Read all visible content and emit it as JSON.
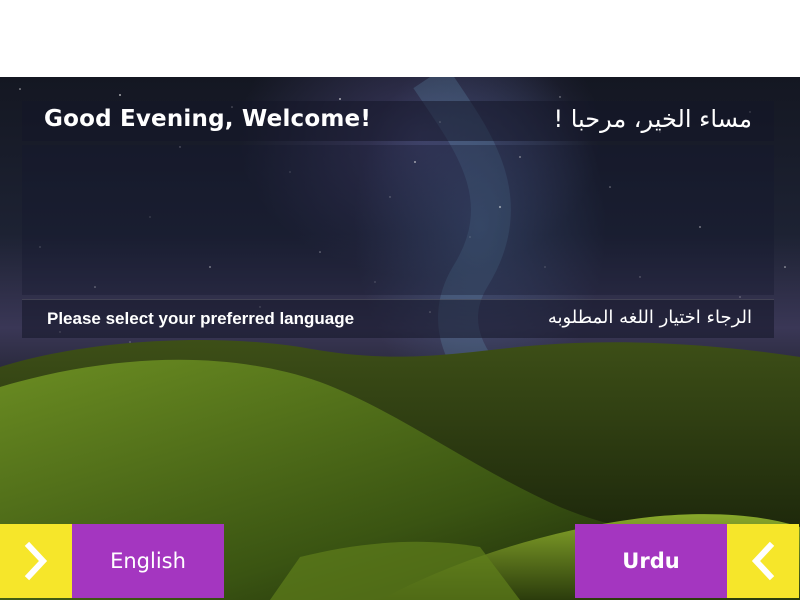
{
  "greeting": {
    "english": "Good Evening, Welcome!",
    "arabic": "مساء الخير، مرحبا !"
  },
  "prompt": {
    "english": "Please select your preferred language",
    "arabic": "الرجاء اختيار اللغه المطلوبه"
  },
  "buttons": {
    "english_label": "English",
    "urdu_label": "Urdu",
    "left_arrow_icon": "chevron-right-icon",
    "right_arrow_icon": "chevron-left-icon"
  },
  "colors": {
    "arrow_button": "#f6e62a",
    "label_button": "#a436c0",
    "text": "#ffffff"
  }
}
